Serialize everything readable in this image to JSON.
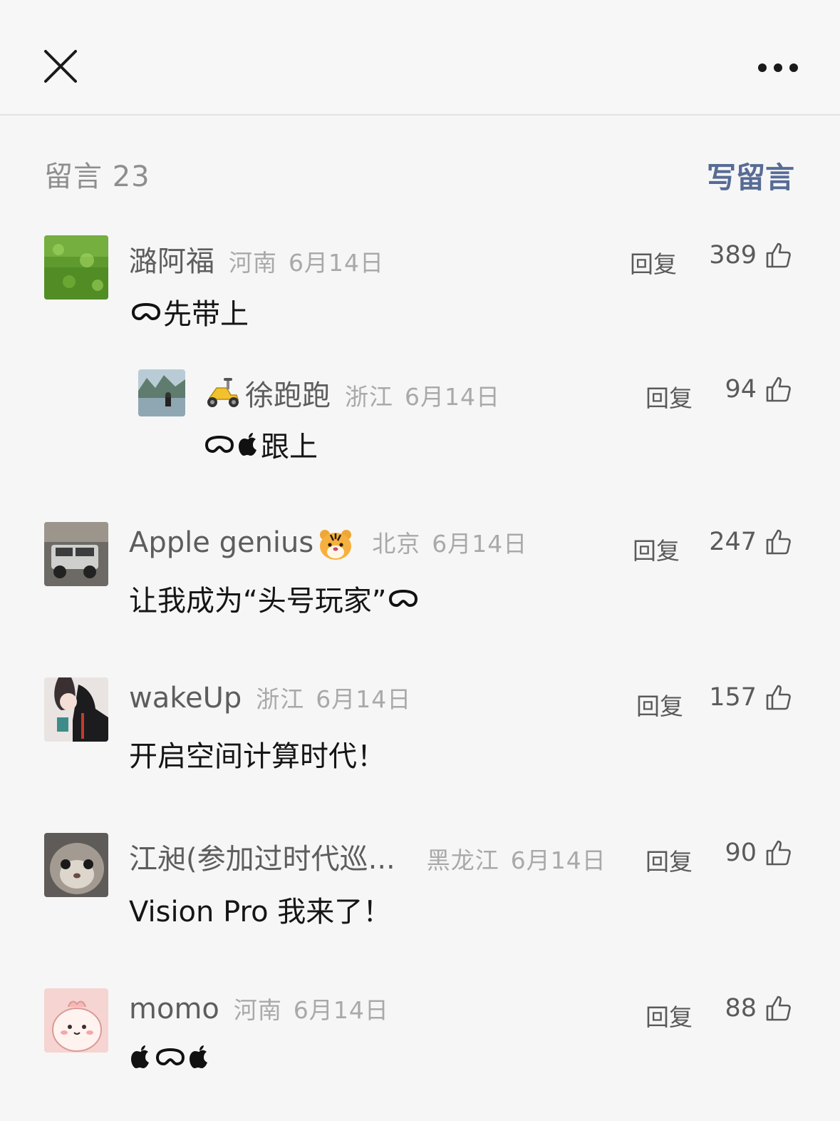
{
  "toolbar": {
    "close_icon": "close-icon",
    "more_icon": "more-icon"
  },
  "header": {
    "comments_label": "留言 23",
    "write_comment": "写留言"
  },
  "comments": [
    {
      "author": "潞阿福",
      "region": "河南",
      "date": "6月14日",
      "reply": "回复",
      "likes": "389",
      "text": "先带上",
      "leading_icon": "vision-pro-icon",
      "avatar": "grass-avatar"
    },
    {
      "author": "徐跑跑",
      "author_emoji": "scooter-emoji",
      "region": "浙江",
      "date": "6月14日",
      "reply": "回复",
      "likes": "94",
      "text": "跟上",
      "leading_icons": [
        "vision-pro-icon",
        "apple-logo-icon"
      ],
      "avatar": "lake-avatar",
      "is_reply": true
    },
    {
      "author": "Apple genius",
      "author_emoji": "tiger-emoji",
      "region": "北京",
      "date": "6月14日",
      "reply": "回复",
      "likes": "247",
      "text": "让我成为“头号玩家”",
      "trailing_icon": "vision-pro-icon",
      "avatar": "jeep-avatar"
    },
    {
      "author": "wakeUp",
      "region": "浙江",
      "date": "6月14日",
      "reply": "回复",
      "likes": "157",
      "text": "开启空间计算时代！",
      "avatar": "anime-avatar"
    },
    {
      "author": "江昶(参加过时代巡...",
      "region": "黑龙江",
      "date": "6月14日",
      "reply": "回复",
      "likes": "90",
      "text": "Vision Pro 我来了！",
      "avatar": "cat-avatar"
    },
    {
      "author": "momo",
      "region": "河南",
      "date": "6月14日",
      "reply": "回复",
      "likes": "88",
      "text": "",
      "icons": [
        "apple-logo-icon",
        "vision-pro-icon",
        "apple-logo-icon"
      ],
      "avatar": "cartoon-avatar"
    }
  ]
}
